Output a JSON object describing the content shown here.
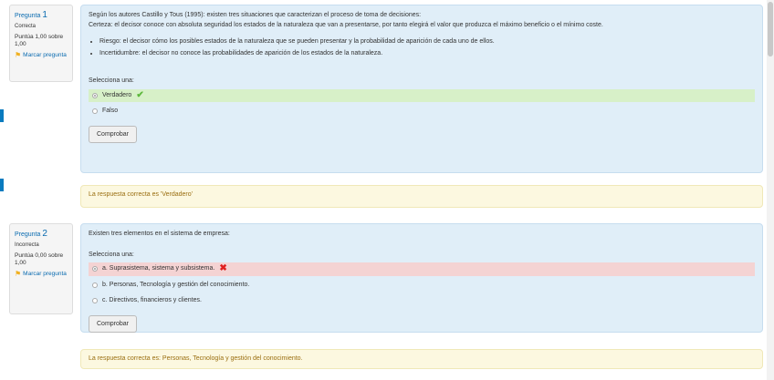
{
  "question1": {
    "label": "Pregunta",
    "number": "1",
    "state": "Correcta",
    "grade": "Puntúa 1,00 sobre 1,00",
    "flag_label": "Marcar pregunta",
    "text_p1": "Según los autores Castillo y Tous (1995): existen tres situaciones que caracterizan el proceso de toma de decisiones:",
    "text_p2": "Certeza: el decisor conoce con absoluta seguridad los estados de la naturaleza que van a presentarse, por tanto elegirá el valor que produzca el máximo beneficio o el mínimo coste.",
    "bullets": [
      "Riesgo: el decisor cómo los posibles estados de la naturaleza que se pueden presentar y la probabilidad de aparición de cada uno de ellos.",
      "Incertidumbre: el decisor no conoce las probabilidades de aparición de los estados de la naturaleza."
    ],
    "select_label": "Selecciona una:",
    "options": [
      "Verdadero",
      "Falso"
    ],
    "check_label": "Comprobar",
    "feedback": "La respuesta correcta es 'Verdadero'"
  },
  "question2": {
    "label": "Pregunta",
    "number": "2",
    "state": "Incorrecta",
    "grade": "Puntúa 0,00 sobre 1,00",
    "flag_label": "Marcar pregunta",
    "text": "Existen tres elementos en el sistema de empresa:",
    "select_label": "Selecciona una:",
    "options": [
      "a. Suprasistema, sistema y subsistema.",
      "b. Personas, Tecnología y gestión del conocimiento.",
      "c. Directivos, financieros y clientes."
    ],
    "check_label": "Comprobar",
    "feedback": "La respuesta correcta es: Personas, Tecnología y gestión del conocimiento."
  },
  "colors": {
    "accent": "#0a7bbf",
    "content_bg": "#e0eef8",
    "correct_bg": "#d7f0c8",
    "incorrect_bg": "#f4d3d3",
    "feedback_bg": "#fcf8e0"
  },
  "icons": {
    "flag": "flag-icon",
    "correct": "check-icon",
    "incorrect": "cross-icon"
  }
}
